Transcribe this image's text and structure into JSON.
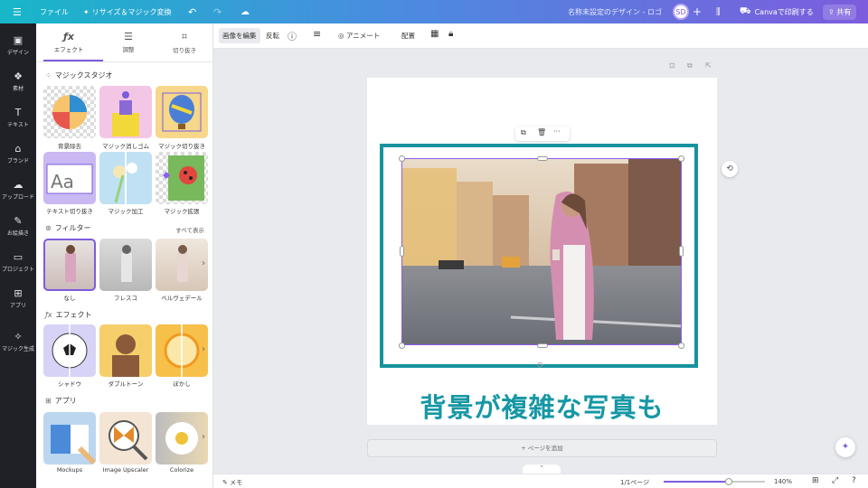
{
  "topbar": {
    "menu_icon": "hamburger-icon",
    "file_label": "ファイル",
    "resize_label": "リサイズ＆マジック変換",
    "doc_title": "名称未設定のデザイン - ロゴ",
    "avatar_initials": "SD",
    "print_label": "Canvaで印刷する",
    "share_label": "共有"
  },
  "rail": [
    {
      "label": "デザイン",
      "icon": "layout-icon",
      "glyph": "▣"
    },
    {
      "label": "素材",
      "icon": "elements-icon",
      "glyph": "❖"
    },
    {
      "label": "テキスト",
      "icon": "text-icon",
      "glyph": "T"
    },
    {
      "label": "ブランド",
      "icon": "brand-icon",
      "glyph": "⌂"
    },
    {
      "label": "アップロード",
      "icon": "upload-icon",
      "glyph": "☁"
    },
    {
      "label": "お絵描き",
      "icon": "draw-icon",
      "glyph": "✎"
    },
    {
      "label": "プロジェクト",
      "icon": "folder-icon",
      "glyph": "▭"
    },
    {
      "label": "アプリ",
      "icon": "apps-icon",
      "glyph": "⊞"
    },
    {
      "label": "マジック生成",
      "icon": "magic-media-icon",
      "glyph": "✧"
    }
  ],
  "panel": {
    "tabs": [
      {
        "label": "エフェクト",
        "glyph": "ƒx"
      },
      {
        "label": "調整",
        "glyph": "☰"
      },
      {
        "label": "切り抜き",
        "glyph": "⌗"
      }
    ],
    "magic_studio": {
      "title": "マジックスタジオ",
      "items": [
        "背景除去",
        "マジック消しゴム",
        "マジック切り抜き",
        "テキスト切り抜き",
        "マジック加工",
        "マジック拡張"
      ]
    },
    "filters": {
      "title": "フィルター",
      "see_all": "すべて表示",
      "items": [
        "なし",
        "フレスコ",
        "ベルヴェデール"
      ]
    },
    "effects": {
      "title": "エフェクト",
      "items": [
        "シャドウ",
        "ダブルトーン",
        "ぼかし"
      ]
    },
    "apps": {
      "title": "アプリ",
      "items": [
        "Mockups",
        "Image Upscaler",
        "Colorize"
      ]
    }
  },
  "context_toolbar": {
    "edit_image": "画像を編集",
    "flip": "反転",
    "animate": "アニメート",
    "position": "配置"
  },
  "canvas": {
    "caption": "背景が複雑な写真も",
    "add_page": "+ ページを追加"
  },
  "bottom": {
    "notes": "メモ",
    "page_indicator": "1/1ページ",
    "zoom": "140%",
    "zoom_fraction": 0.64
  },
  "colors": {
    "accent": "#7d5cdd",
    "caption": "#1697a5",
    "frame": "#17929e"
  }
}
